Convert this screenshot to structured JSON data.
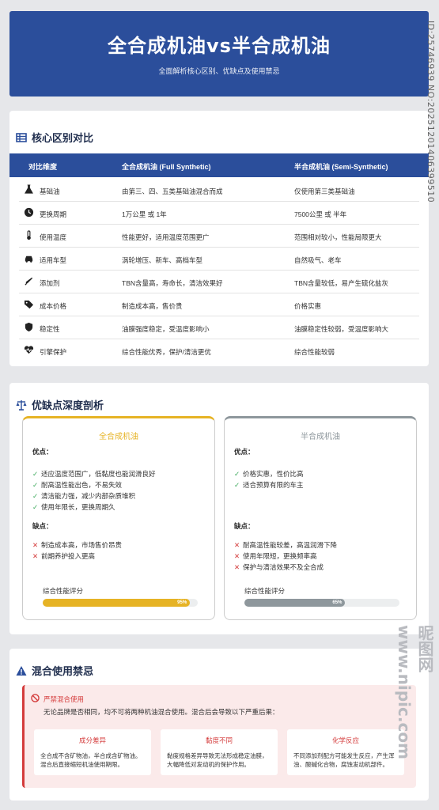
{
  "header": {
    "title": "全合成机油vs半合成机油",
    "subtitle": "全面解析核心区别、优缺点及使用禁忌"
  },
  "section1": {
    "title": "核心区别对比",
    "headers": [
      "对比维度",
      "全合成机油 (Full Synthetic)",
      "半合成机油 (Semi-Synthetic)"
    ],
    "rows": [
      {
        "icon": "flask-icon",
        "dim": "基础油",
        "full": "由第三、四、五类基础油混合而成",
        "semi": "仅使用第三类基础油"
      },
      {
        "icon": "clock-icon",
        "dim": "更换周期",
        "full": "1万公里 或 1年",
        "semi": "7500公里 或 半年"
      },
      {
        "icon": "thermometer-icon",
        "dim": "使用温度",
        "full": "性能更好，适用温度范围更广",
        "semi": "范围相对较小，性能局限更大"
      },
      {
        "icon": "car-icon",
        "dim": "适用车型",
        "full": "涡轮增压、新车、高档车型",
        "semi": "自然吸气、老车"
      },
      {
        "icon": "syringe-icon",
        "dim": "添加剂",
        "full": "TBN含量高，寿命长，清洁效果好",
        "semi": "TBN含量较低，易产生硫化盐灰"
      },
      {
        "icon": "tag-icon",
        "dim": "成本价格",
        "full": "制造成本高，售价贵",
        "semi": "价格实惠"
      },
      {
        "icon": "shield-icon",
        "dim": "稳定性",
        "full": "油膜强度稳定，受温度影响小",
        "semi": "油膜稳定性较弱，受温度影响大"
      },
      {
        "icon": "heartbeat-icon",
        "dim": "引擎保护",
        "full": "综合性能优秀，保护/清洁更优",
        "semi": "综合性能较弱"
      }
    ]
  },
  "section2": {
    "title": "优缺点深度剖析",
    "full": {
      "title": "全合成机油",
      "pros_label": "优点：",
      "pros": [
        "适应温度范围广，低黏度也能润滑良好",
        "耐高温性能出色，不易失效",
        "清洁能力强，减少内部杂质堆积",
        "使用年限长，更换周期久"
      ],
      "cons_label": "缺点：",
      "cons": [
        "制造成本高，市场售价昂贵",
        "前期养护投入更高"
      ],
      "score_label": "综合性能评分",
      "score": 95,
      "score_text": "95%",
      "color": "#e6b325"
    },
    "semi": {
      "title": "半合成机油",
      "pros_label": "优点：",
      "pros": [
        "价格实惠，性价比高",
        "适合预算有限的车主"
      ],
      "cons_label": "缺点：",
      "cons": [
        "耐高温性能较差，高温润滑下降",
        "使用年限短，更换频率高",
        "保护与清洁效果不及全合成"
      ],
      "score_label": "综合性能评分",
      "score": 65,
      "score_text": "65%",
      "color": "#8e979c"
    }
  },
  "section3": {
    "title": "混合使用禁忌",
    "warn_title": "严禁混合使用",
    "warn_desc": "无论品牌是否相同，均不可将两种机油混合使用。混合后会导致以下严重后果：",
    "cards": [
      {
        "title": "成分差异",
        "desc": "全合成不含矿物油，半合成含矿物油。混合后直接缩短机油使用期限。"
      },
      {
        "title": "黏度不同",
        "desc": "黏度规格差异导致无法形成稳定油膜，大幅降低对发动机的保护作用。"
      },
      {
        "title": "化学反应",
        "desc": "不同添加剂配方可能发生反应，产生浑浊、酸碱化合物，腐蚀发动机部件。"
      }
    ]
  },
  "watermark": {
    "id_text": "ID:25746939 NO:20251201406399510",
    "site": "昵图网 www.nipic.com"
  }
}
